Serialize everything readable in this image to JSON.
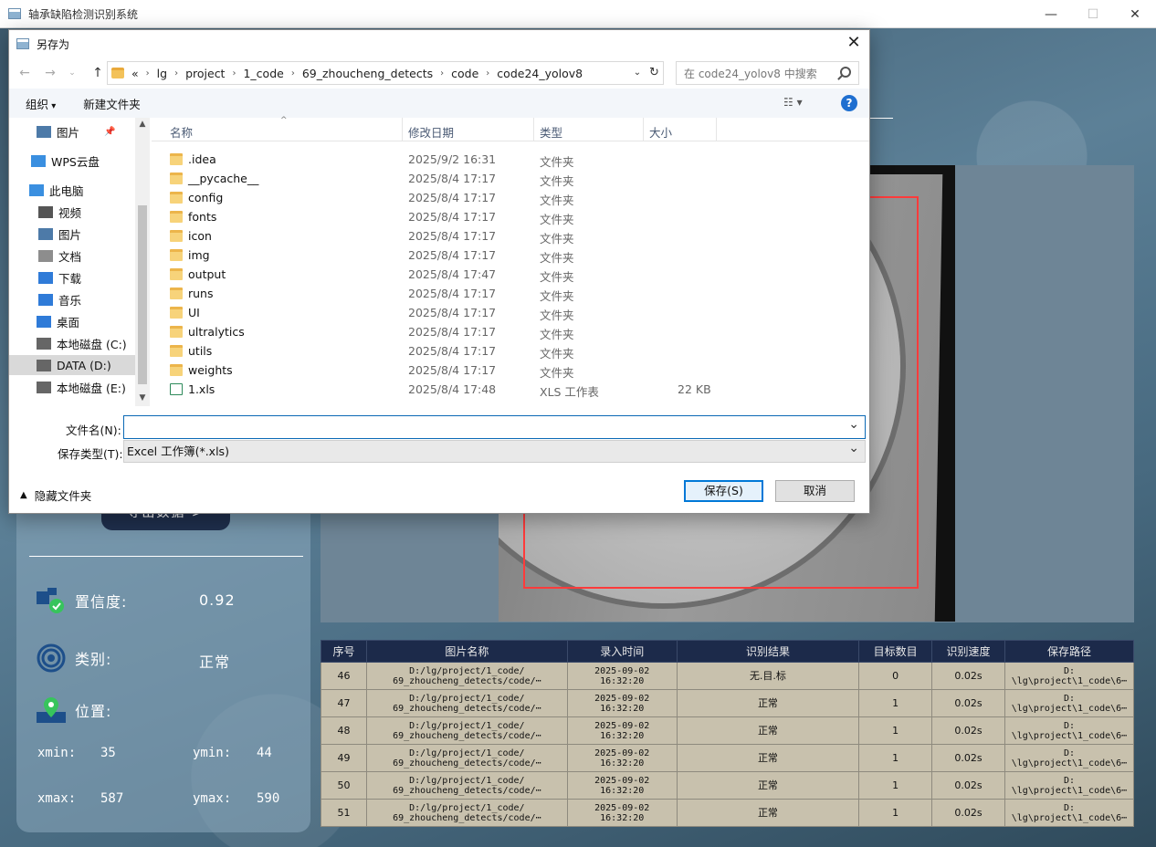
{
  "app": {
    "title": "轴承缺陷检测识别系统",
    "export_label": "导出数据 >"
  },
  "info": {
    "confidence_label": "置信度:",
    "confidence_value": "0.92",
    "class_label": "类别:",
    "class_value": "正常",
    "position_label": "位置:",
    "xmin_label": "xmin:",
    "xmin_value": "35",
    "ymin_label": "ymin:",
    "ymin_value": "44",
    "xmax_label": "xmax:",
    "xmax_value": "587",
    "ymax_label": "ymax:",
    "ymax_value": "590"
  },
  "table": {
    "headers": [
      "序号",
      "图片名称",
      "录入时间",
      "识别结果",
      "目标数目",
      "识别速度",
      "保存路径"
    ],
    "rows": [
      {
        "no": "46",
        "name1": "D:/lg/project/1_code/",
        "name2": "69_zhoucheng_detects/code/⋯",
        "date": "2025-09-02",
        "time": "16:32:20",
        "result": "无.目.标",
        "count": "0",
        "speed": "0.02s",
        "path1": "D:",
        "path2": "\\lg\\project\\1_code\\6⋯"
      },
      {
        "no": "47",
        "name1": "D:/lg/project/1_code/",
        "name2": "69_zhoucheng_detects/code/⋯",
        "date": "2025-09-02",
        "time": "16:32:20",
        "result": "正常",
        "count": "1",
        "speed": "0.02s",
        "path1": "D:",
        "path2": "\\lg\\project\\1_code\\6⋯"
      },
      {
        "no": "48",
        "name1": "D:/lg/project/1_code/",
        "name2": "69_zhoucheng_detects/code/⋯",
        "date": "2025-09-02",
        "time": "16:32:20",
        "result": "正常",
        "count": "1",
        "speed": "0.02s",
        "path1": "D:",
        "path2": "\\lg\\project\\1_code\\6⋯"
      },
      {
        "no": "49",
        "name1": "D:/lg/project/1_code/",
        "name2": "69_zhoucheng_detects/code/⋯",
        "date": "2025-09-02",
        "time": "16:32:20",
        "result": "正常",
        "count": "1",
        "speed": "0.02s",
        "path1": "D:",
        "path2": "\\lg\\project\\1_code\\6⋯"
      },
      {
        "no": "50",
        "name1": "D:/lg/project/1_code/",
        "name2": "69_zhoucheng_detects/code/⋯",
        "date": "2025-09-02",
        "time": "16:32:20",
        "result": "正常",
        "count": "1",
        "speed": "0.02s",
        "path1": "D:",
        "path2": "\\lg\\project\\1_code\\6⋯"
      },
      {
        "no": "51",
        "name1": "D:/lg/project/1_code/",
        "name2": "69_zhoucheng_detects/code/⋯",
        "date": "2025-09-02",
        "time": "16:32:20",
        "result": "正常",
        "count": "1",
        "speed": "0.02s",
        "path1": "D:",
        "path2": "\\lg\\project\\1_code\\6⋯"
      }
    ]
  },
  "dialog": {
    "title": "另存为",
    "path": [
      "«",
      "lg",
      "project",
      "1_code",
      "69_zhoucheng_detects",
      "code",
      "code24_yolov8"
    ],
    "search_placeholder": "在 code24_yolov8 中搜索",
    "organize": "组织",
    "new_folder": "新建文件夹",
    "nav_items": [
      {
        "label": "图片",
        "icon": "pictures-icon"
      },
      {
        "label": "WPS云盘",
        "icon": "cloud-icon"
      },
      {
        "label": "此电脑",
        "icon": "computer-icon"
      },
      {
        "label": "视频",
        "icon": "video-icon"
      },
      {
        "label": "图片",
        "icon": "pictures-icon"
      },
      {
        "label": "文档",
        "icon": "document-icon"
      },
      {
        "label": "下载",
        "icon": "download-icon"
      },
      {
        "label": "音乐",
        "icon": "music-icon"
      },
      {
        "label": "桌面",
        "icon": "desktop-icon"
      },
      {
        "label": "本地磁盘 (C:)",
        "icon": "drive-icon"
      },
      {
        "label": "DATA (D:)",
        "icon": "drive-icon"
      },
      {
        "label": "本地磁盘 (E:)",
        "icon": "drive-icon"
      }
    ],
    "columns": [
      "名称",
      "修改日期",
      "类型",
      "大小"
    ],
    "files": [
      {
        "name": ".idea",
        "date": "2025/9/2 16:31",
        "type": "文件夹",
        "size": ""
      },
      {
        "name": "__pycache__",
        "date": "2025/8/4 17:17",
        "type": "文件夹",
        "size": ""
      },
      {
        "name": "config",
        "date": "2025/8/4 17:17",
        "type": "文件夹",
        "size": ""
      },
      {
        "name": "fonts",
        "date": "2025/8/4 17:17",
        "type": "文件夹",
        "size": ""
      },
      {
        "name": "icon",
        "date": "2025/8/4 17:17",
        "type": "文件夹",
        "size": ""
      },
      {
        "name": "img",
        "date": "2025/8/4 17:17",
        "type": "文件夹",
        "size": ""
      },
      {
        "name": "output",
        "date": "2025/8/4 17:47",
        "type": "文件夹",
        "size": ""
      },
      {
        "name": "runs",
        "date": "2025/8/4 17:17",
        "type": "文件夹",
        "size": ""
      },
      {
        "name": "UI",
        "date": "2025/8/4 17:17",
        "type": "文件夹",
        "size": ""
      },
      {
        "name": "ultralytics",
        "date": "2025/8/4 17:17",
        "type": "文件夹",
        "size": ""
      },
      {
        "name": "utils",
        "date": "2025/8/4 17:17",
        "type": "文件夹",
        "size": ""
      },
      {
        "name": "weights",
        "date": "2025/8/4 17:17",
        "type": "文件夹",
        "size": ""
      },
      {
        "name": "1.xls",
        "date": "2025/8/4 17:48",
        "type": "XLS 工作表",
        "size": "22 KB"
      }
    ],
    "filename_label": "文件名(N):",
    "filename_value": "",
    "filetype_label": "保存类型(T):",
    "filetype_value": "Excel 工作簿(*.xls)",
    "hide_folders": "隐藏文件夹",
    "save": "保存(S)",
    "cancel": "取消"
  }
}
